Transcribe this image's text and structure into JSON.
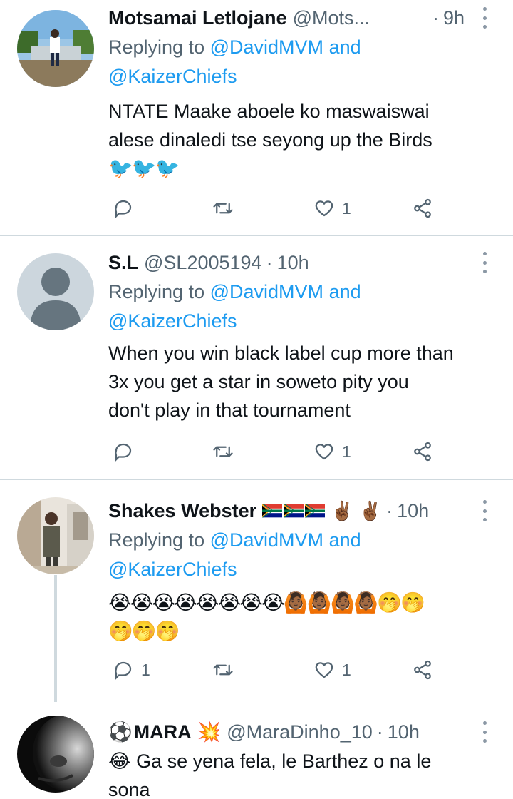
{
  "tweets": [
    {
      "name": "Motsamai Letlojane",
      "handle": "@Mots...",
      "time": "9h",
      "reply_prefix": "Replying to",
      "reply_to_1": "@DavidMVM",
      "reply_and": "and",
      "reply_to_2": "@KaizerChiefs",
      "text_lines": [
        "NTATE Maake aboele ko maswaiswai",
        "alese dinaledi tse seyong up the Birds"
      ],
      "emoji_line": "🐦🐦🐦",
      "reply_count": "",
      "retweet_count": "",
      "like_count": "1"
    },
    {
      "name": "S.L",
      "handle": "@SL2005194",
      "time": "10h",
      "reply_prefix": "Replying to",
      "reply_to_1": "@DavidMVM",
      "reply_and": "and",
      "reply_to_2": "@KaizerChiefs",
      "text_lines": [
        "When you win black label cup more than",
        "3x you get a star in soweto pity you",
        "don't play in that tournament"
      ],
      "reply_count": "",
      "retweet_count": "",
      "like_count": "1"
    },
    {
      "name": "Shakes Webster",
      "name_hands": "✌🏾 ✌🏾",
      "handle": "",
      "time": "10h",
      "reply_prefix": "Replying to",
      "reply_to_1": "@DavidMVM",
      "reply_and": "and",
      "reply_to_2": "@KaizerChiefs",
      "emoji_line_1": "😭😭😭😭😭😭😭😭🙆🏾🙆🏾🙆🏾🙆🏾🤭🤭",
      "emoji_line_2": "🤭🤭🤭",
      "reply_count": "1",
      "retweet_count": "",
      "like_count": "1"
    },
    {
      "name_prefix": "⚽",
      "name": "MARA",
      "name_suffix": "💥",
      "handle": "@MaraDinho_10",
      "time": "10h",
      "text_prefix_emoji": "😂",
      "text_lines": [
        "Ga se yena fela, le Barthez o na le",
        "sona"
      ]
    }
  ],
  "icons": {
    "reply": "reply-bubble-icon",
    "retweet": "retweet-icon",
    "like": "heart-icon",
    "share": "share-icon",
    "more": "more-vertical-icon"
  },
  "colors": {
    "link": "#1d9bf0",
    "secondary_text": "#536471",
    "separator": "#cfd9de"
  }
}
